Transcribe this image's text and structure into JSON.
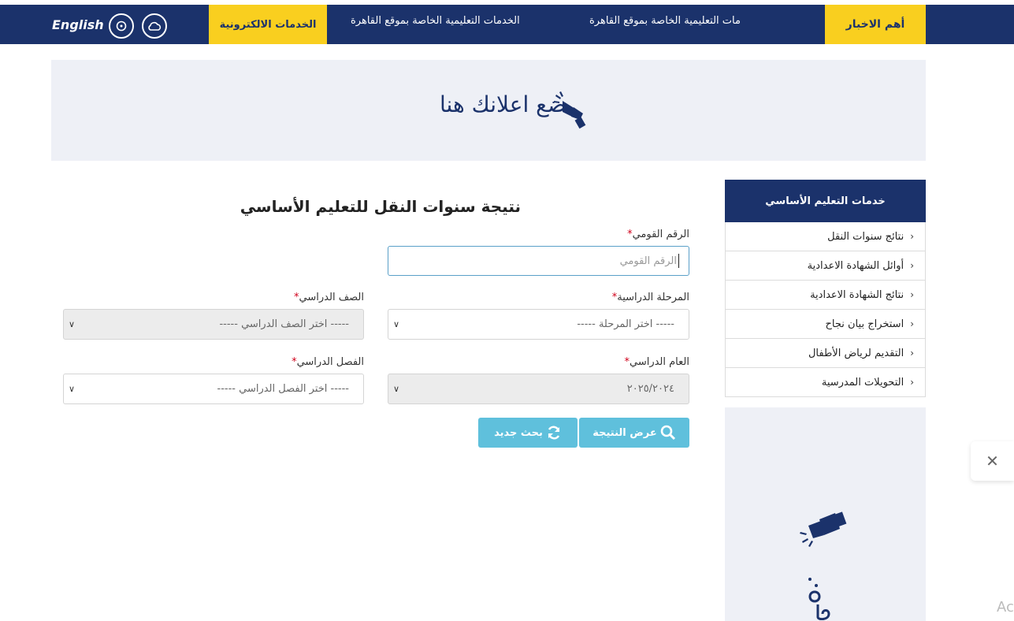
{
  "topbar": {
    "news_label": "أهم الاخبار",
    "ticker_items": [
      "مات التعليمية الخاصة بموقع القاهرة",
      "الخدمات التعليمية الخاصة بموقع القاهرة"
    ],
    "eservices_label": "الخدمات الالكترونية",
    "language_label": "English"
  },
  "ad": {
    "text": "ضع اعلانك هنا"
  },
  "sidebar": {
    "title": "خدمات التعليم الأساسي",
    "items": [
      {
        "label": "نتائج سنوات النقل"
      },
      {
        "label": "أوائل الشهادة الاعدادية"
      },
      {
        "label": "نتائج الشهادة الاعدادية"
      },
      {
        "label": "استخراج بيان نجاح"
      },
      {
        "label": "التقديم لرياض الأطفال"
      },
      {
        "label": "التحويلات المدرسية"
      }
    ]
  },
  "form": {
    "title": "نتيجة سنوات النقل للتعليم الأساسي",
    "national_id": {
      "label": "الرقم القومي",
      "placeholder": "الرقم القومي"
    },
    "stage": {
      "label": "المرحلة الدراسية",
      "value": "----- اختر المرحلة -----"
    },
    "grade": {
      "label": "الصف الدراسي",
      "value": "----- اختر الصف الدراسي -----"
    },
    "year": {
      "label": "العام الدراسي",
      "value": "٢٠٢٥/٢٠٢٤"
    },
    "term": {
      "label": "الفصل الدراسي",
      "value": "----- اختر الفصل الدراسي -----"
    },
    "show_result_label": "عرض النتيجة",
    "new_search_label": "بحث جديد"
  },
  "overlay": {
    "close_glyph": "✕",
    "watermark": "Ac"
  },
  "colors": {
    "navy": "#1b326b",
    "yellow": "#f9cf1f",
    "button": "#5fc0dc"
  }
}
